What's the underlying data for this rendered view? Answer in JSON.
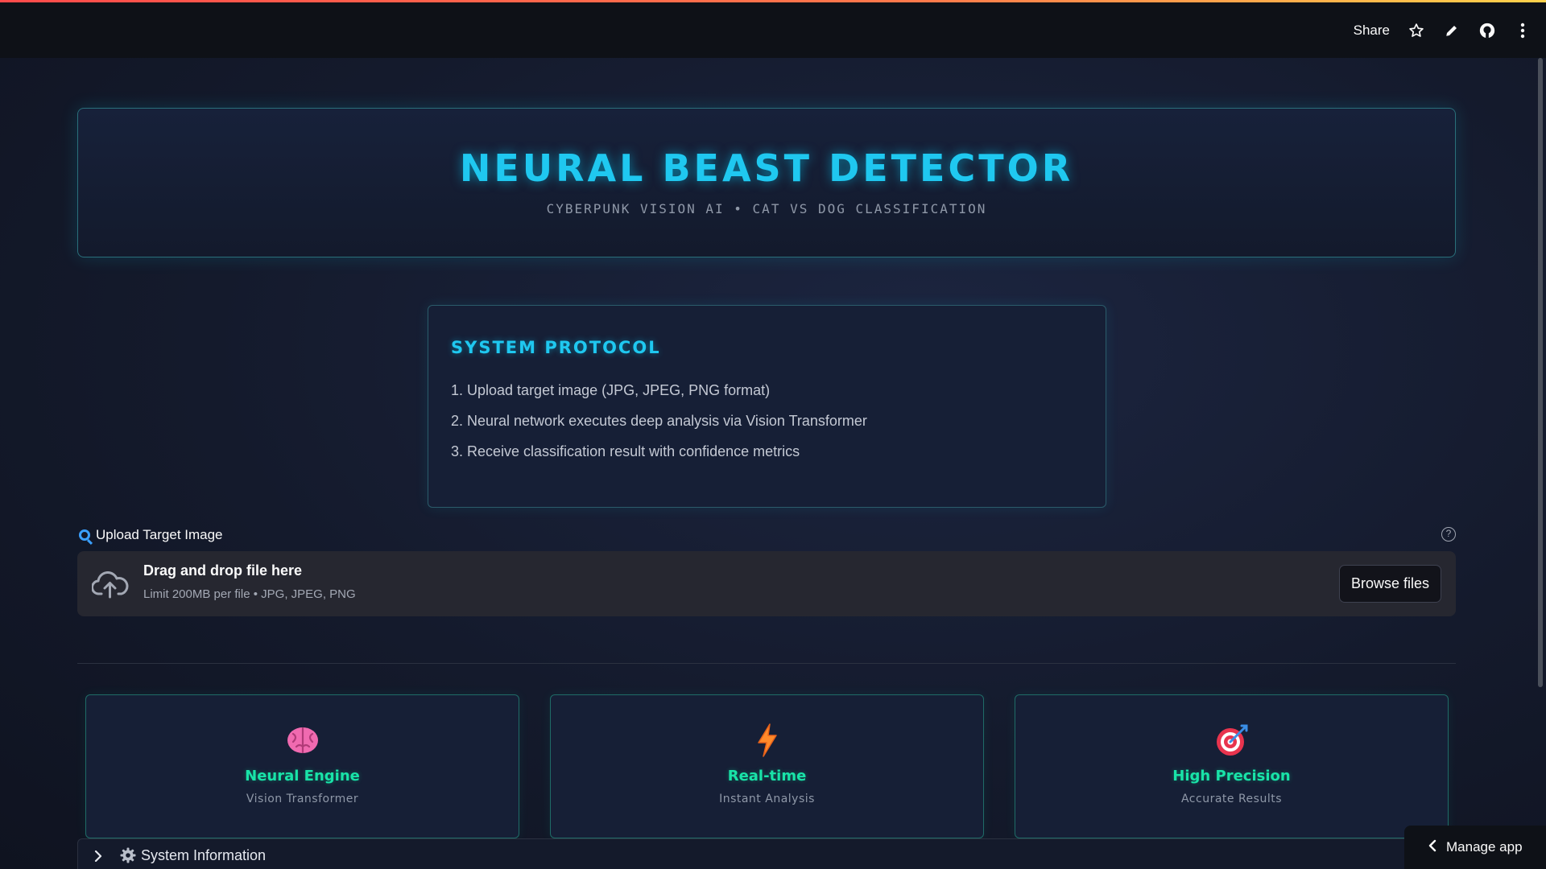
{
  "toolbar": {
    "share_label": "Share",
    "icons": [
      "star-icon",
      "pencil-icon",
      "github-icon",
      "more-vertical-icon"
    ]
  },
  "hero": {
    "title": "NEURAL BEAST DETECTOR",
    "subtitle": "CYBERPUNK VISION AI • CAT VS DOG CLASSIFICATION"
  },
  "protocol": {
    "title": "SYSTEM PROTOCOL",
    "steps": [
      "1. Upload target image (JPG, JPEG, PNG format)",
      "2. Neural network executes deep analysis via Vision Transformer",
      "3. Receive classification result with confidence metrics"
    ]
  },
  "uploader": {
    "label": "Upload Target Image",
    "drop_title": "Drag and drop file here",
    "limit_text": "Limit 200MB per file • JPG, JPEG, PNG",
    "browse_label": "Browse files"
  },
  "features": [
    {
      "icon": "brain-icon",
      "title": "Neural Engine",
      "subtitle": "Vision Transformer"
    },
    {
      "icon": "lightning-icon",
      "title": "Real-time",
      "subtitle": "Instant Analysis"
    },
    {
      "icon": "target-icon",
      "title": "High Precision",
      "subtitle": "Accurate Results"
    }
  ],
  "system_info": {
    "label": "System Information"
  },
  "manage_app": {
    "label": "Manage app"
  },
  "colors": {
    "accent_cyan": "#1fc8f0",
    "accent_green": "#19e3a8",
    "background": "#141a2c",
    "topbar": "#0e1117"
  }
}
